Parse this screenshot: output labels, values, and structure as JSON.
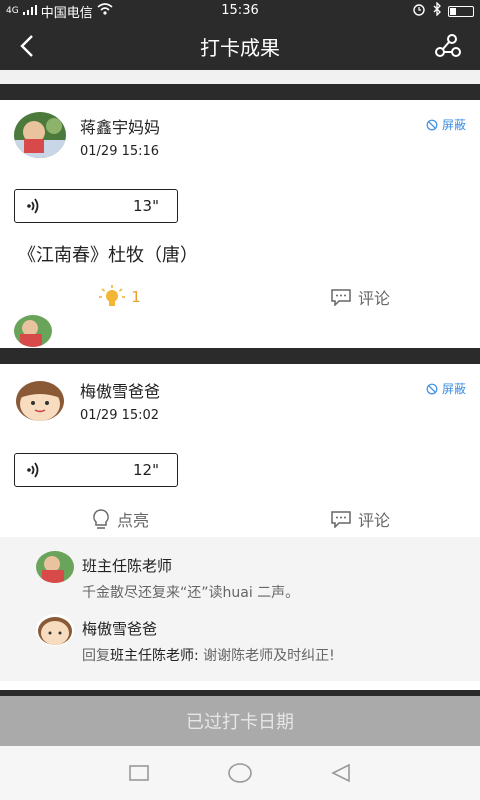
{
  "status": {
    "carrier": "中国电信",
    "time": "15:36",
    "network": "4G"
  },
  "header": {
    "title": "打卡成果"
  },
  "posts": [
    {
      "user": "蒋鑫宇妈妈",
      "time": "01/29 15:16",
      "block_label": "屏蔽",
      "audio_duration": "13\"",
      "poem": "《江南春》杜牧（唐）",
      "like_count": "1",
      "comment_label": "评论"
    },
    {
      "user": "梅傲雪爸爸",
      "time": "01/29 15:02",
      "block_label": "屏蔽",
      "audio_duration": "12\"",
      "like_label": "点亮",
      "comment_label": "评论",
      "comments": [
        {
          "name": "班主任陈老师",
          "text": "千金散尽还复来“还”读huai 二声。"
        },
        {
          "name": "梅傲雪爸爸",
          "reply_prefix": "回复",
          "reply_to": "班主任陈老师:",
          "text": " 谢谢陈老师及时纠正!"
        }
      ]
    }
  ],
  "footer": {
    "button_label": "已过打卡日期"
  },
  "icons": {
    "back": "back-arrow-icon",
    "share": "share-icon",
    "block": "block-icon",
    "audio": "sound-wave-icon",
    "like_active": "lightbulb-lit-icon",
    "like": "lightbulb-icon",
    "comment": "comment-icon"
  },
  "colors": {
    "accent_blue": "#3a8ee6",
    "like_gold": "#e8a12b",
    "dark_bar": "#2b2b2b",
    "disabled_button": "#aaaaaa"
  }
}
